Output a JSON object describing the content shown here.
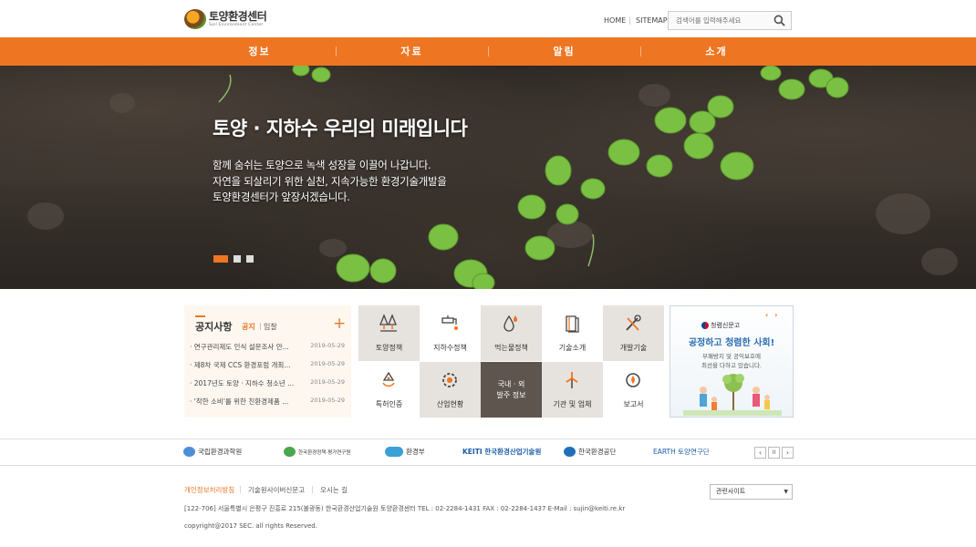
{
  "header": {
    "logo_name": "토양환경센터",
    "logo_sub": "Soil Environment Center",
    "util_home": "HOME",
    "util_sep": "|",
    "util_sitemap": "SITEMAP",
    "search_placeholder": "검색어를 입력해주세요"
  },
  "gnb": {
    "items": [
      "정보",
      "자료",
      "알림",
      "소개"
    ]
  },
  "hero": {
    "title": "토양 · 지하수 우리의 미래입니다",
    "lines": [
      "함께 숨쉬는 토양으로 녹색 성장을 이끌어 나갑니다.",
      "자연을 되살리기 위한 실천, 지속가능한 환경기술개발을",
      "토양환경센터가 앞장서겠습니다."
    ],
    "slide_count": 3,
    "active_slide": 1
  },
  "notice": {
    "title": "공지사항",
    "tab_active": "공지",
    "tab_sep": "|",
    "tab_other": "입찰",
    "more": "+",
    "items": [
      {
        "text": "· 연구관리제도 인식 설문조사 안...",
        "date": "2019-05-29"
      },
      {
        "text": "· 제8차 국제 CCS 환경포럼 개최...",
        "date": "2019-05-29"
      },
      {
        "text": "· 2017년도 토양 · 지하수 청소년 ...",
        "date": "2019-05-29"
      },
      {
        "text": "· '착한 소비'를 위한 친환경제품 ...",
        "date": "2019-05-29"
      }
    ]
  },
  "grid": {
    "row1": [
      "토양정책",
      "지하수정책",
      "먹는물정책",
      "기술소개",
      "개발기술"
    ],
    "row2": [
      "특허인증",
      "산업현황",
      "국내 · 외",
      "기관 및 업체",
      "보고서"
    ],
    "row2_dark_line2": "발주 정보",
    "accent": "#ee7522"
  },
  "campaign": {
    "arrows": "‹ ›",
    "badge": "청렴신문고",
    "title": "공정하고 청렴한 사회!",
    "desc1": "부패방지 및 공익보호에",
    "desc2": "최선을 다하고 있습니다."
  },
  "partners": {
    "items": [
      "국립환경과학원",
      "한국환경정책·평가연구원",
      "환경부",
      "KEITI 한국환경산업기술원",
      "한국환경공단",
      "EARTH 토양연구단"
    ],
    "prev": "‹",
    "pause": "II",
    "next": "›"
  },
  "footer": {
    "links": [
      "개인정보처리방침",
      "기술원사이버신문고",
      "오시는 길"
    ],
    "sep": "|",
    "address": "[122-706] 서울특별시 은평구 진흥로 215(불광동) 한국환경산업기술원 토양환경센터     TEL : 02-2284-1431     FAX : 02-2284-1437     E-Mail : sujin@keiti.re.kr",
    "copyright": "copyright@2017 SEC. all rights Reserved.",
    "related_select": "관련사이트",
    "select_arrow": "▼"
  },
  "colors": {
    "brand_orange": "#ee7522",
    "campaign_blue": "#2c6eb5",
    "dark_cell": "#5e554e"
  }
}
